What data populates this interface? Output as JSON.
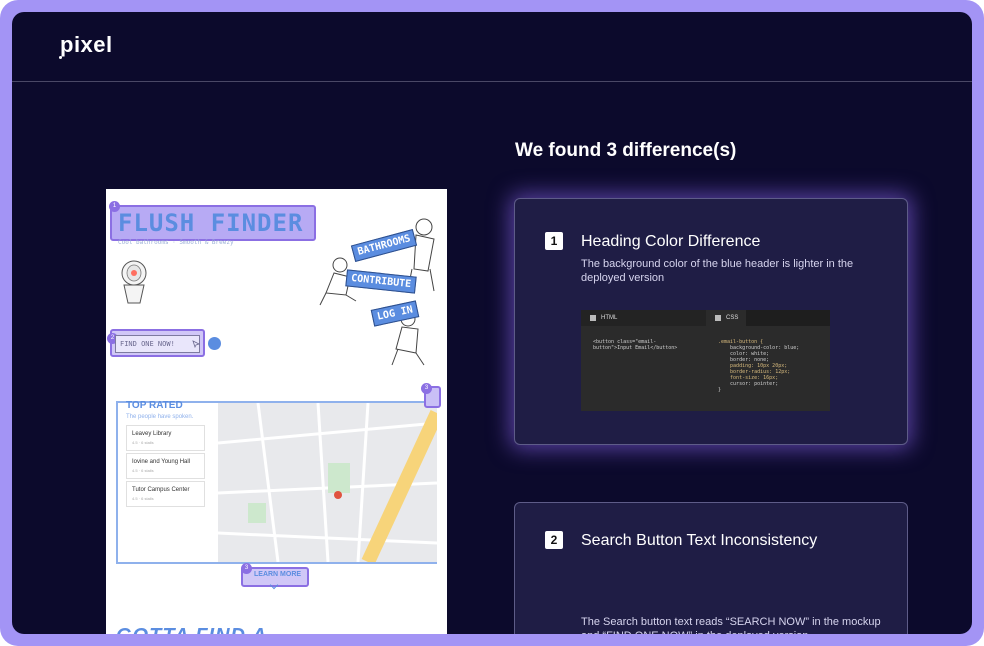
{
  "app": {
    "logo": "pixel"
  },
  "headline": "We found 3 difference(s)",
  "mockup": {
    "title": "FLUSH FINDER",
    "subtitle": "Cool bathrooms · Smooth & Breezy",
    "tags": [
      "BATHROOMS",
      "CONTRIBUTE",
      "LOG IN"
    ],
    "search_text": "FIND ONE NOW!",
    "top_rated_title": "TOP RATED",
    "top_rated_sub": "The people have spoken.",
    "locations": [
      {
        "name": "Leavey Library",
        "meta": "4.5 · 6 stalls"
      },
      {
        "name": "Iovine and Young Hall",
        "meta": "4.5 · 6 stalls"
      },
      {
        "name": "Tutor Campus Center",
        "meta": "4.5 · 6 stalls"
      }
    ],
    "learn_more": "LEARN MORE",
    "footer_heading": "GOTTA FIND A",
    "markers": [
      "1",
      "2",
      "3",
      "3"
    ]
  },
  "differences": [
    {
      "number": "1",
      "title": "Heading Color Difference",
      "description": "The background color of the blue header is lighter in the deployed version",
      "code": {
        "tabs": [
          "HTML",
          "CSS"
        ],
        "html_lines": [
          "<button class=\"email-",
          "button\">Input Email</button>"
        ],
        "css_lines": [
          ".email-button {",
          "    background-color: blue;",
          "    color: white;",
          "    border: none;",
          "    padding: 10px 20px;",
          "    border-radius: 12px;",
          "    font-size: 16px;",
          "    cursor: pointer;",
          "}"
        ]
      }
    },
    {
      "number": "2",
      "title": "Search Button Text Inconsistency",
      "description": "The Search button text reads “SEARCH NOW” in the mockup and “FIND ONE NOW” in the deployed version"
    }
  ],
  "colors": {
    "accent": "#a394f5",
    "background": "#0c0a2c",
    "card": "#1f1d45",
    "mock_blue": "#5b8de0"
  }
}
